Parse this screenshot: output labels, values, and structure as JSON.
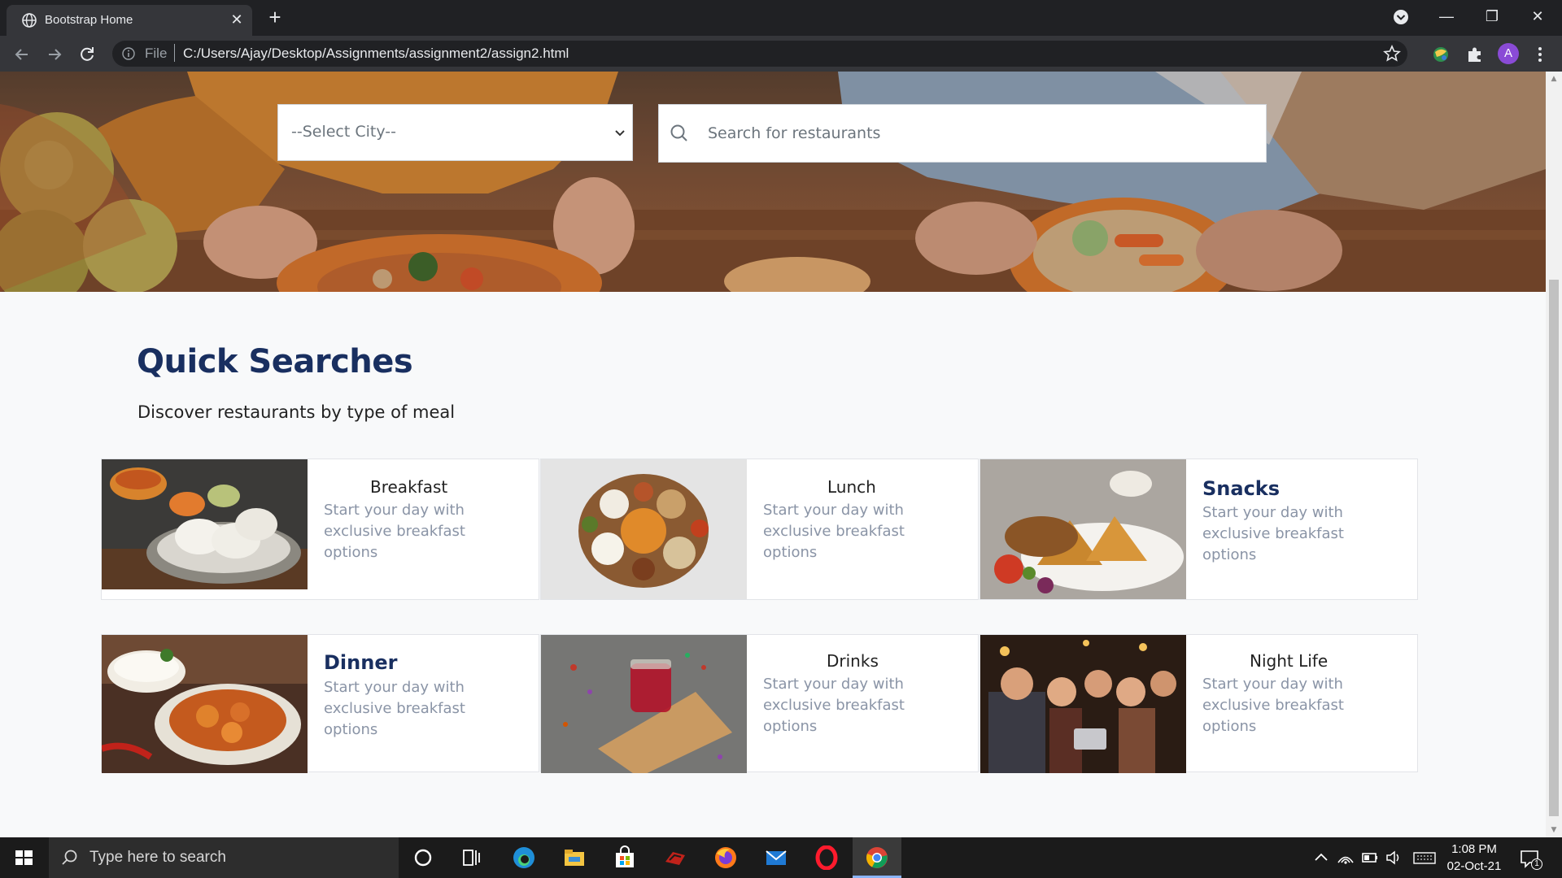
{
  "browser": {
    "tab_title": "Bootstrap Home",
    "tab_close": "✕",
    "new_tab": "+",
    "scheme_label": "File",
    "url": "C:/Users/Ajay/Desktop/Assignments/assignment2/assign2.html",
    "profile_initial": "A",
    "window_controls": {
      "minimize": "—",
      "restore": "❐",
      "close": "✕"
    }
  },
  "hero": {
    "city_select_value": "--Select City--",
    "search_placeholder": "Search for restaurants"
  },
  "quick_searches": {
    "title": "Quick Searches",
    "subtitle": "Discover restaurants by type of meal",
    "cards": [
      {
        "title": "Breakfast",
        "description": "Start your day with exclusive breakfast options",
        "image": "idli-sambar-photo"
      },
      {
        "title": "Lunch",
        "description": "Start your day with exclusive breakfast options",
        "image": "thali-bowls-photo"
      },
      {
        "title": "Snacks",
        "description": "Start your day with exclusive breakfast options",
        "image": "samosa-plate-photo"
      },
      {
        "title": "Dinner",
        "description": "Start your day with exclusive breakfast options",
        "image": "curry-rice-photo"
      },
      {
        "title": "Drinks",
        "description": "Start your day with exclusive breakfast options",
        "image": "tea-glass-photo"
      },
      {
        "title": "Night Life",
        "description": "Start your day with exclusive breakfast options",
        "image": "party-selfie-photo"
      }
    ]
  },
  "taskbar": {
    "search_placeholder": "Type here to search",
    "apps": [
      "cortana-icon",
      "task-view-icon",
      "edge-icon",
      "file-explorer-icon",
      "store-icon",
      "game-icon",
      "firefox-icon",
      "mail-icon",
      "opera-icon",
      "chrome-icon"
    ],
    "time": "1:08 PM",
    "date": "02-Oct-21",
    "notification_count": "1"
  },
  "colors": {
    "heading": "#192f60",
    "muted_text": "#8a94a6",
    "chrome_dark": "#202124",
    "chrome_toolbar": "#35363a"
  }
}
